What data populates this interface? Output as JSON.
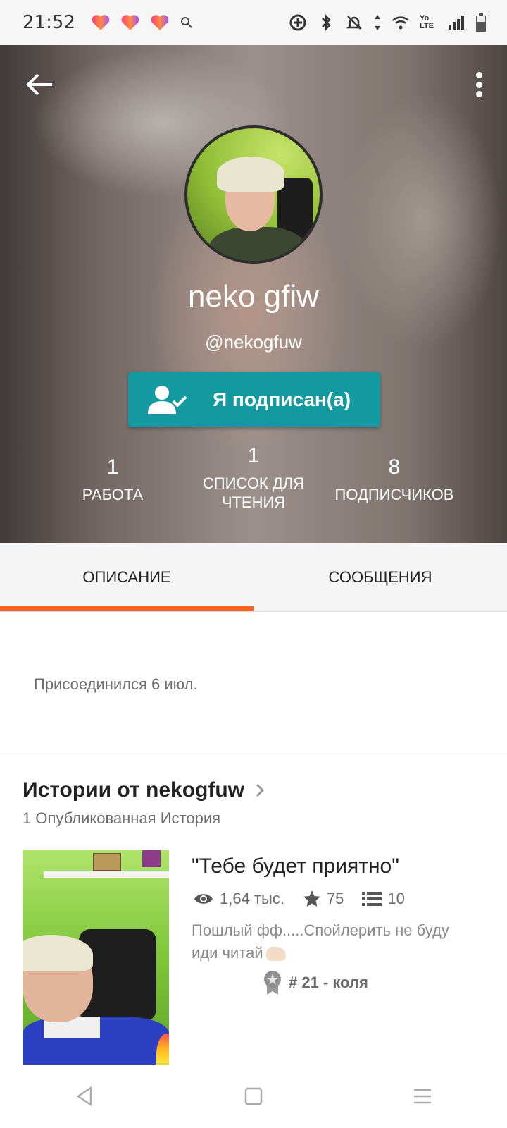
{
  "status_bar": {
    "time": "21:52",
    "notification_icons": [
      "heart-app-icon",
      "heart-app-icon",
      "heart-app-icon",
      "search-icon"
    ],
    "right_icons": [
      "data-saver-icon",
      "bluetooth-icon",
      "mute-icon",
      "data-arrows-icon",
      "wifi-icon",
      "volte-icon",
      "signal-icon",
      "battery-icon"
    ],
    "volte_label": "Yo LTE"
  },
  "profile": {
    "display_name": "neko gfiw",
    "username": "@nekogfuw",
    "follow_button_label": "Я подписан(а)",
    "stats": [
      {
        "value": "1",
        "label": "РАБОТА"
      },
      {
        "value": "1",
        "label": "СПИСОК ДЛЯ ЧТЕНИЯ"
      },
      {
        "value": "8",
        "label": "ПОДПИСЧИКОВ"
      }
    ]
  },
  "tabs": [
    {
      "label": "ОПИСАНИЕ",
      "active": true
    },
    {
      "label": "СООБЩЕНИЯ",
      "active": false
    }
  ],
  "about": {
    "joined": "Присоединился 6 июл."
  },
  "stories": {
    "title": "Истории от nekogfuw",
    "count_text": "1 Опубликованная История",
    "items": [
      {
        "title": "\"Тебе будет приятно\"",
        "reads": "1,64 тыс.",
        "votes": "75",
        "parts": "10",
        "description": "Пошлый фф.....Спойлерить не буду иди читай",
        "rank": "# 21 - коля"
      }
    ]
  },
  "colors": {
    "accent_orange": "#ff6122",
    "follow_teal": "#139aa0"
  }
}
